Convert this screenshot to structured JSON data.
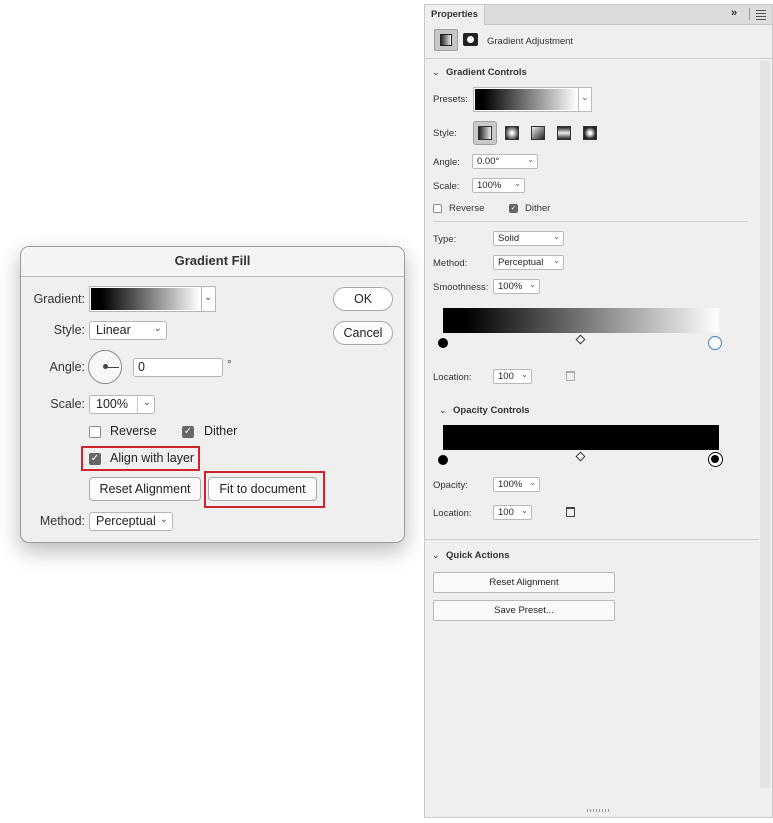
{
  "dialog": {
    "title": "Gradient Fill",
    "gradient_label": "Gradient:",
    "style_label": "Style:",
    "style_value": "Linear",
    "angle_label": "Angle:",
    "angle_value": "0",
    "degree_symbol": "°",
    "scale_label": "Scale:",
    "scale_value": "100%",
    "reverse_label": "Reverse",
    "reverse_checked": false,
    "dither_label": "Dither",
    "dither_checked": true,
    "align_label": "Align with layer",
    "align_checked": true,
    "reset_alignment_label": "Reset Alignment",
    "fit_to_document_label": "Fit to document",
    "method_label": "Method:",
    "method_value": "Perceptual",
    "ok_label": "OK",
    "cancel_label": "Cancel"
  },
  "panel": {
    "tab_title": "Properties",
    "adjustment_title": "Gradient Adjustment",
    "gradient_controls": {
      "heading": "Gradient Controls",
      "presets_label": "Presets:",
      "style_label": "Style:",
      "angle_label": "Angle:",
      "angle_value": "0.00°",
      "scale_label": "Scale:",
      "scale_value": "100%",
      "reverse_label": "Reverse",
      "reverse_checked": false,
      "dither_label": "Dither",
      "dither_checked": true,
      "type_label": "Type:",
      "type_value": "Solid",
      "method_label": "Method:",
      "method_value": "Perceptual",
      "smoothness_label": "Smoothness:",
      "smoothness_value": "100%",
      "location_label": "Location:",
      "location_value": "100"
    },
    "opacity_controls": {
      "heading": "Opacity Controls",
      "opacity_label": "Opacity:",
      "opacity_value": "100%",
      "location_label": "Location:",
      "location_value": "100"
    },
    "quick_actions": {
      "heading": "Quick Actions",
      "reset_alignment_label": "Reset Alignment",
      "save_preset_label": "Save Preset..."
    }
  },
  "colors": {
    "highlight": "#d2232a",
    "color_stop_selected": "#3b82c4"
  }
}
